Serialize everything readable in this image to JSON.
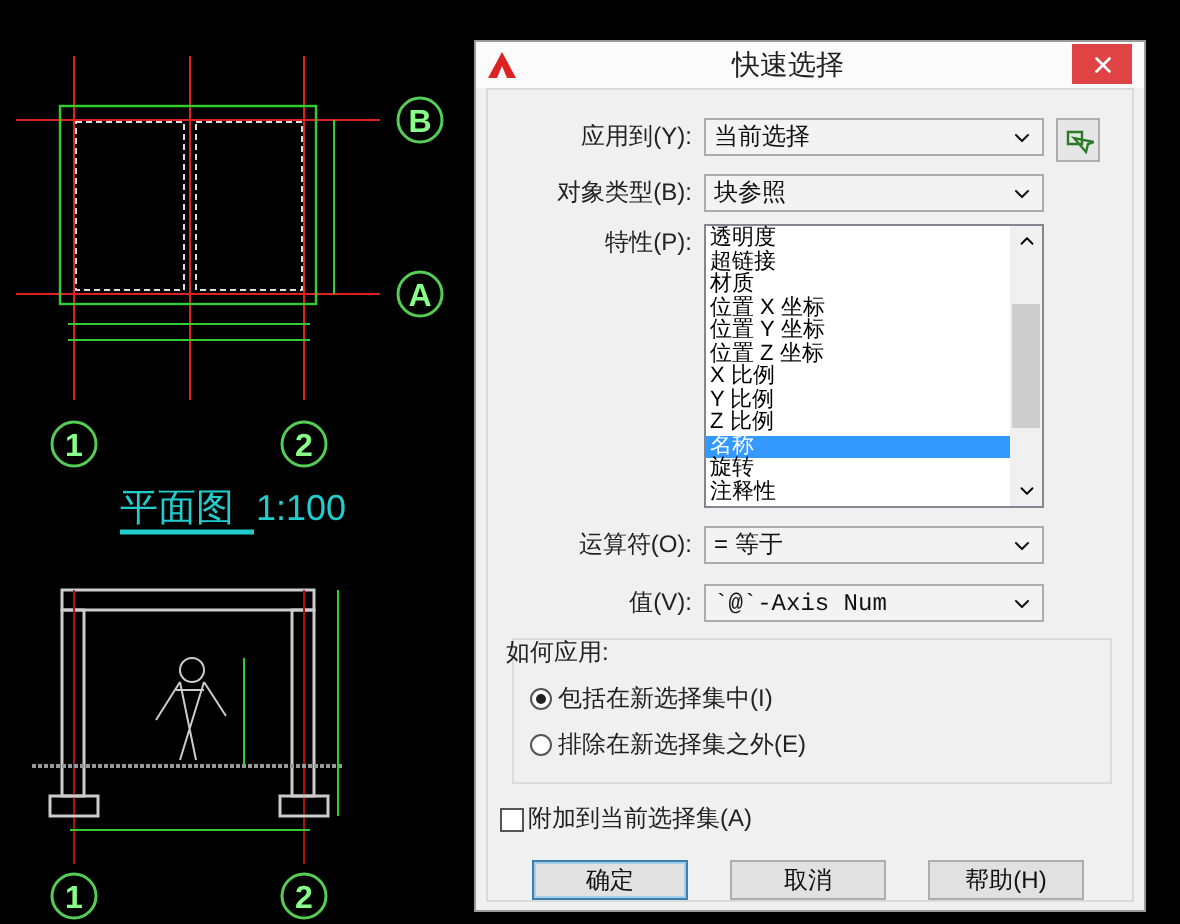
{
  "drawing": {
    "axis_bubbles": [
      {
        "label": "B"
      },
      {
        "label": "A"
      },
      {
        "label": "1"
      },
      {
        "label": "2"
      },
      {
        "label": "1"
      },
      {
        "label": "2"
      }
    ],
    "title": "平面图",
    "scale": "1:100"
  },
  "dialog": {
    "title": "快速选择",
    "apply_to": {
      "label": "应用到(Y):",
      "value": "当前选择"
    },
    "object_type": {
      "label": "对象类型(B):",
      "value": "块参照"
    },
    "properties": {
      "label": "特性(P):",
      "items": [
        {
          "label": "透明度",
          "selected": false
        },
        {
          "label": "超链接",
          "selected": false
        },
        {
          "label": "材质",
          "selected": false
        },
        {
          "label": "位置 X 坐标",
          "selected": false
        },
        {
          "label": "位置 Y 坐标",
          "selected": false
        },
        {
          "label": "位置 Z 坐标",
          "selected": false
        },
        {
          "label": "X 比例",
          "selected": false
        },
        {
          "label": "Y 比例",
          "selected": false
        },
        {
          "label": "Z 比例",
          "selected": false
        },
        {
          "label": "名称",
          "selected": true
        },
        {
          "label": "旋转",
          "selected": false
        },
        {
          "label": "注释性",
          "selected": false
        }
      ]
    },
    "operator": {
      "label": "运算符(O):",
      "value": "= 等于"
    },
    "value": {
      "label": "值(V):",
      "value": "`@`-Axis Num"
    },
    "how_to_apply": {
      "label": "如何应用:",
      "options": [
        {
          "label": "包括在新选择集中(I)",
          "selected": true
        },
        {
          "label": "排除在新选择集之外(E)",
          "selected": false
        }
      ]
    },
    "append": {
      "label": "附加到当前选择集(A)",
      "checked": false
    },
    "buttons": [
      {
        "label": "确定",
        "default": true
      },
      {
        "label": "取消",
        "default": false
      },
      {
        "label": "帮助(H)",
        "default": false
      }
    ]
  }
}
